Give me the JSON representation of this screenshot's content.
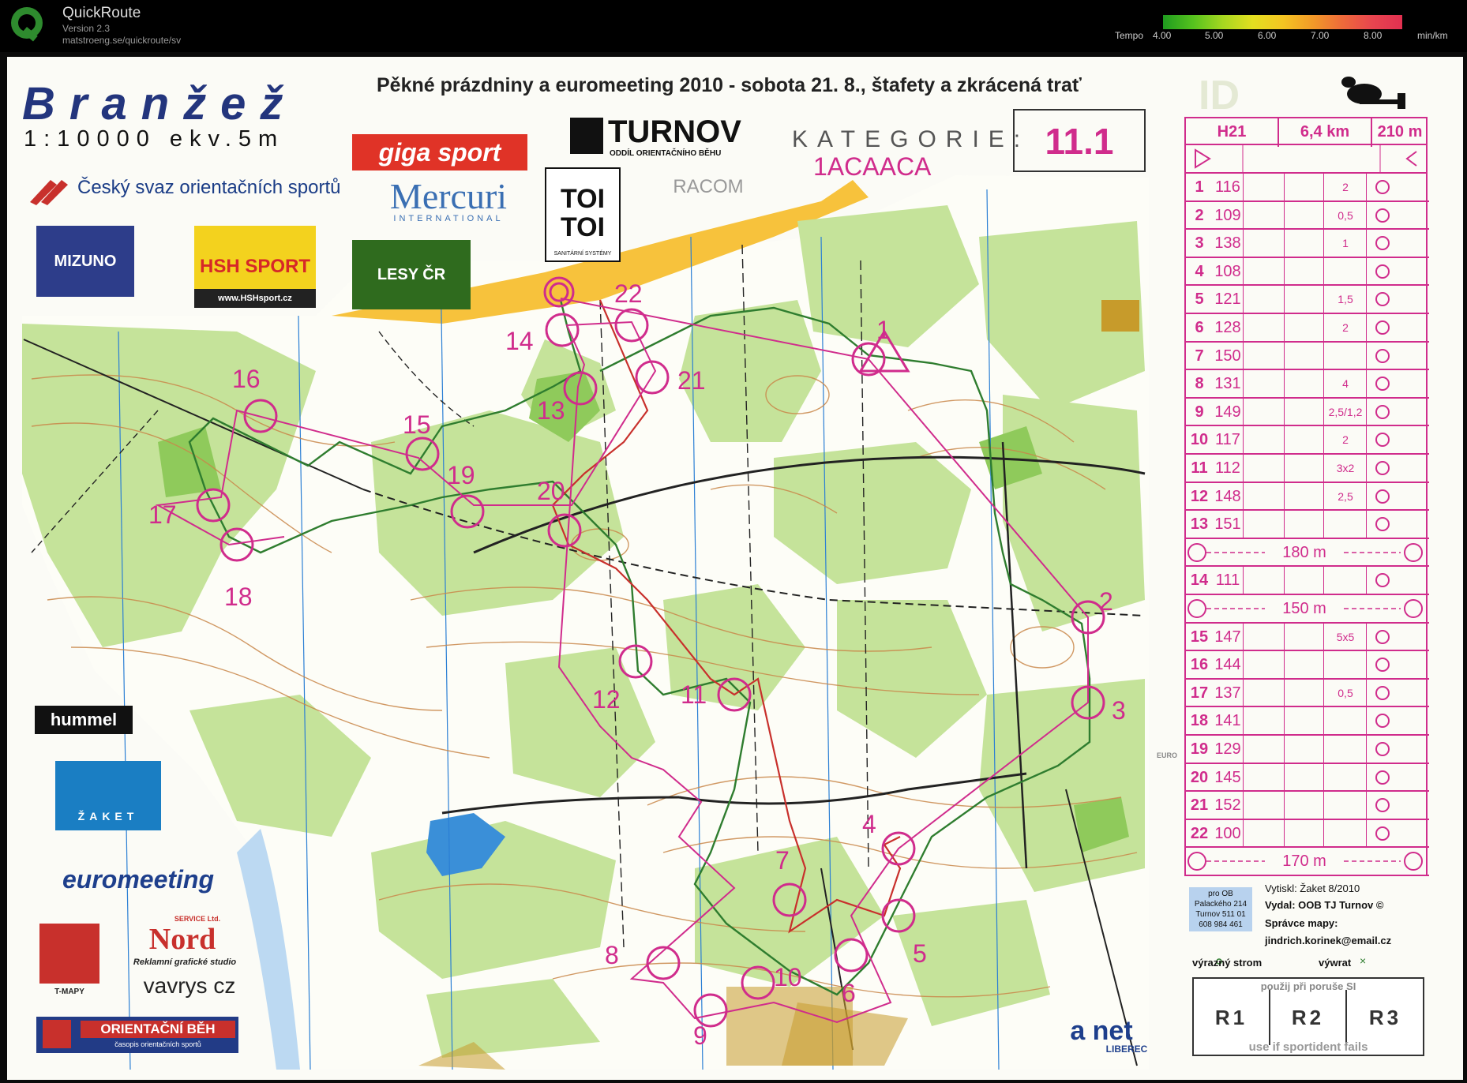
{
  "app": {
    "name": "QuickRoute",
    "version": "Version 2.3",
    "url": "matstroeng.se/quickroute/sv"
  },
  "pace_legend": {
    "prefix": "Tempo",
    "ticks": [
      "4.00",
      "5.00",
      "6.00",
      "7.00",
      "8.00"
    ],
    "unit": "min/km"
  },
  "map": {
    "title": "Pěkné prázdniny a euromeeting 2010 - sobota 21. 8., štafety a zkrácená trať",
    "name": "Branžež",
    "scale": "1:10000  ekv.5m",
    "federation": "Český svaz orientačních sportů",
    "category_label": "KATEGORIE:",
    "category_value": "11.1",
    "code": "1ACAACA",
    "sponsors": [
      "giga sport",
      "TURNOV",
      "ODDÍL ORIENTAČNÍHO BĚHU",
      "TOI TOI",
      "SANITÁRNÍ SYSTÉMY",
      "RACOM",
      "Mercuri",
      "INTERNATIONAL",
      "MIZUNO",
      "HSH SPORT",
      "www.HSHsport.cz",
      "LESY ČR",
      "hummel",
      "ŽAKET",
      "euromeeting",
      "SERVICE Ltd.",
      "Nord",
      "Reklamní grafické studio",
      "T-MAPY",
      "vavrys cz",
      "ORIENTAČNÍ BĚH",
      "časopis orientačních sportů",
      "a net",
      "LIBEREC",
      "EURO",
      "ID"
    ],
    "print_box": [
      "pro OB",
      "Palackého 214",
      "Turnov 511 01",
      "608 984 461"
    ],
    "footer": {
      "printed": "Vytiskl: Žaket 8/2010",
      "issued": "Vydal: OOB TJ Turnov ©",
      "manager": "Správce mapy:",
      "email": "jindrich.korinek@email.cz"
    },
    "legend_items": [
      "výrazný strom",
      "výwrat"
    ],
    "backup": {
      "top": "použij při poruše SI",
      "bottom": "use if sportident fails",
      "boxes": [
        "R1",
        "R2",
        "R3"
      ]
    },
    "controls_on_map": [
      "1",
      "2",
      "3",
      "4",
      "5",
      "6",
      "7",
      "8",
      "9",
      "10",
      "11",
      "12",
      "13",
      "14",
      "15",
      "16",
      "17",
      "18",
      "19",
      "20",
      "21",
      "22"
    ]
  },
  "control_description": {
    "header": [
      "H21",
      "6,4 km",
      "210 m"
    ],
    "rows": [
      {
        "n": "1",
        "code": "116",
        "dim": "2"
      },
      {
        "n": "2",
        "code": "109",
        "dim": "0,5"
      },
      {
        "n": "3",
        "code": "138",
        "dim": "1"
      },
      {
        "n": "4",
        "code": "108",
        "dim": ""
      },
      {
        "n": "5",
        "code": "121",
        "dim": "1,5"
      },
      {
        "n": "6",
        "code": "128",
        "dim": "2"
      },
      {
        "n": "7",
        "code": "150",
        "dim": ""
      },
      {
        "n": "8",
        "code": "131",
        "dim": "4"
      },
      {
        "n": "9",
        "code": "149",
        "dim": "2,5/1,2"
      },
      {
        "n": "10",
        "code": "117",
        "dim": "2"
      },
      {
        "n": "11",
        "code": "112",
        "dim": "3x2"
      },
      {
        "n": "12",
        "code": "148",
        "dim": "2,5"
      },
      {
        "n": "13",
        "code": "151",
        "dim": ""
      },
      {
        "tape": "180 m"
      },
      {
        "n": "14",
        "code": "111",
        "dim": ""
      },
      {
        "tape": "150 m"
      },
      {
        "n": "15",
        "code": "147",
        "dim": "5x5"
      },
      {
        "n": "16",
        "code": "144",
        "dim": ""
      },
      {
        "n": "17",
        "code": "137",
        "dim": "0,5"
      },
      {
        "n": "18",
        "code": "141",
        "dim": ""
      },
      {
        "n": "19",
        "code": "129",
        "dim": ""
      },
      {
        "n": "20",
        "code": "145",
        "dim": ""
      },
      {
        "n": "21",
        "code": "152",
        "dim": ""
      },
      {
        "n": "22",
        "code": "100",
        "dim": ""
      },
      {
        "tape": "170 m"
      }
    ]
  },
  "colors": {
    "course": "#d02c8c",
    "route_green": "#2f7d2f",
    "route_red": "#c8302c",
    "forest": "#c5e39a",
    "open": "#f7c23c",
    "blue": "#2b7fd4",
    "track_start": "#1f9b1f",
    "track_end": "#e13050"
  }
}
